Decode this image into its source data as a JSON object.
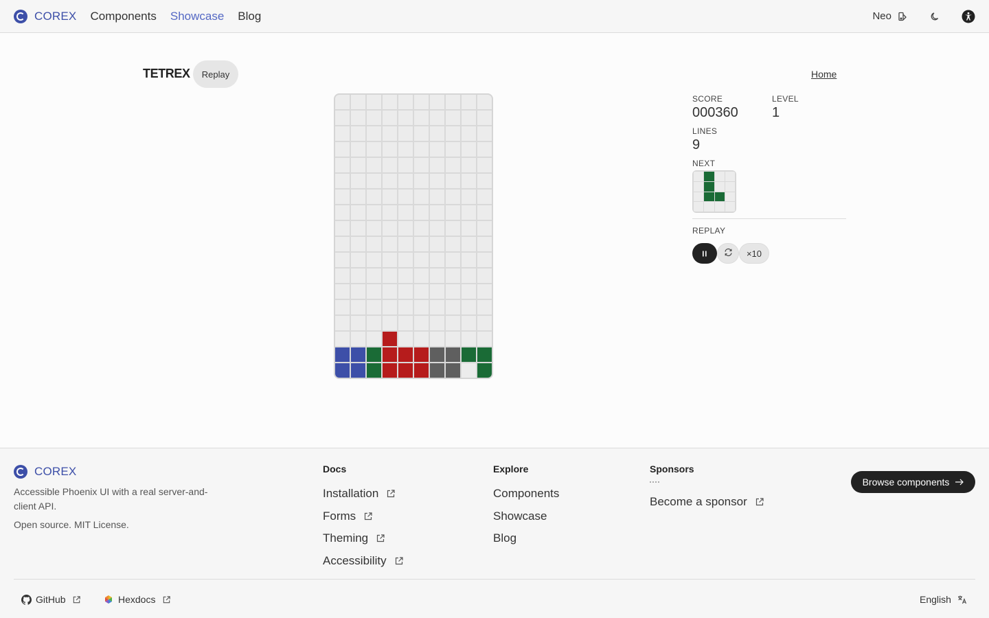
{
  "header": {
    "brand": "COREX",
    "nav": [
      {
        "label": "Components",
        "active": false
      },
      {
        "label": "Showcase",
        "active": true
      },
      {
        "label": "Blog",
        "active": false
      }
    ],
    "theme_label": "Neo",
    "icons": [
      "theme-brush-icon",
      "moon-icon",
      "accessibility-icon"
    ]
  },
  "game": {
    "title": "TETREX",
    "replay_chip": "Replay",
    "home_link": "Home",
    "score_label": "SCORE",
    "score": "000360",
    "level_label": "LEVEL",
    "level": "1",
    "lines_label": "LINES",
    "lines": "9",
    "next_label": "NEXT",
    "replay_label": "REPLAY",
    "speed_label": "×10",
    "colors": {
      "b": "#3d4fa8",
      "g": "#1a6b36",
      "r": "#b61c1c",
      "d": "#5f5f5f",
      "empty": "#ececec"
    },
    "board": [
      "..........",
      "..........",
      "..........",
      "..........",
      "..........",
      "..........",
      "..........",
      "..........",
      "..........",
      "..........",
      "..........",
      "..........",
      "..........",
      "..........",
      "..........",
      "...r......",
      "bbgrrrddgg",
      "bbgrrrdd.g"
    ],
    "next_piece": [
      ".g..",
      ".g..",
      ".gg.",
      "...."
    ]
  },
  "footer": {
    "brand": "COREX",
    "tagline": "Accessible Phoenix UI with a real server-and-client API.",
    "license": "Open source. MIT License.",
    "docs_title": "Docs",
    "docs": [
      "Installation",
      "Forms",
      "Theming",
      "Accessibility"
    ],
    "explore_title": "Explore",
    "explore": [
      "Components",
      "Showcase",
      "Blog"
    ],
    "sponsors_title": "Sponsors",
    "sponsor_link": "Become a sponsor",
    "cta": "Browse components",
    "github": "GitHub",
    "hexdocs": "Hexdocs",
    "language": "English"
  }
}
